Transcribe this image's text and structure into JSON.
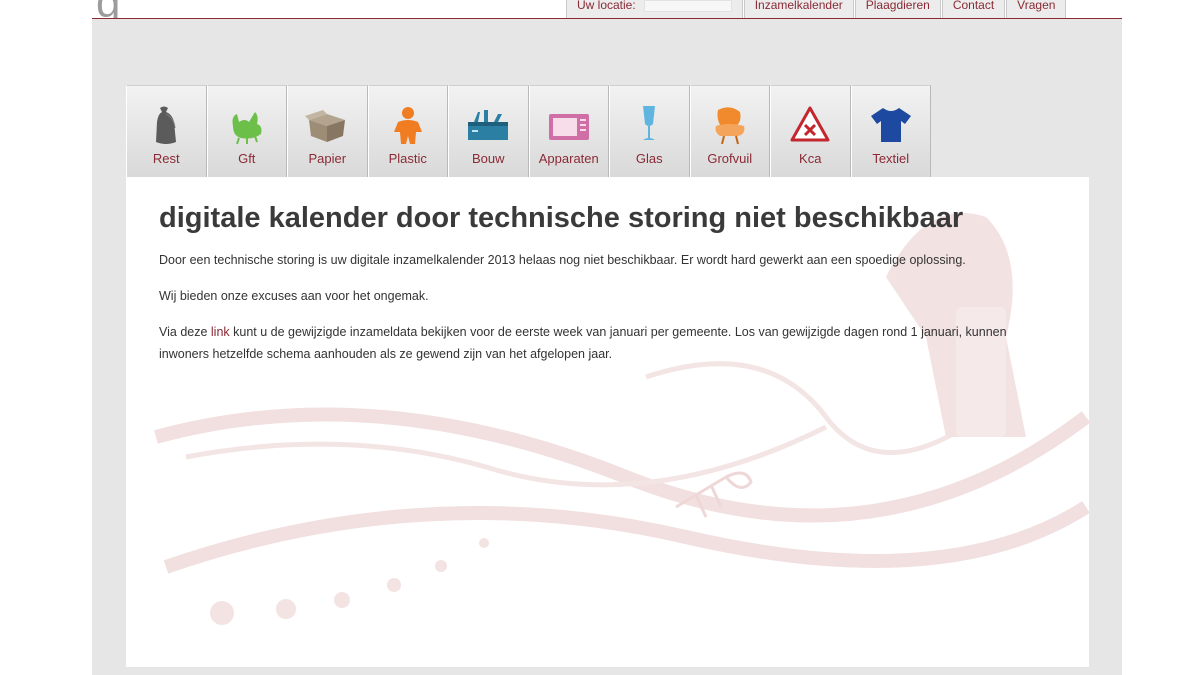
{
  "header": {
    "logo_fragment": "g",
    "nav": [
      {
        "label": "Uw locatie:",
        "has_input": true
      },
      {
        "label": "Inzamelkalender"
      },
      {
        "label": "Plaagdieren"
      },
      {
        "label": "Contact"
      },
      {
        "label": "Vragen"
      }
    ]
  },
  "categories": [
    {
      "label": "Rest",
      "icon": "trash-bag-icon",
      "color": "#5b5b5b"
    },
    {
      "label": "Gft",
      "icon": "green-waste-icon",
      "color": "#6cc04a"
    },
    {
      "label": "Papier",
      "icon": "cardboard-box-icon",
      "color": "#9d8c76"
    },
    {
      "label": "Plastic",
      "icon": "plastic-figure-icon",
      "color": "#f07d22"
    },
    {
      "label": "Bouw",
      "icon": "toolbox-icon",
      "color": "#2a7fa3"
    },
    {
      "label": "Apparaten",
      "icon": "microwave-icon",
      "color": "#d06fa6"
    },
    {
      "label": "Glas",
      "icon": "glass-icon",
      "color": "#5fb5e0"
    },
    {
      "label": "Grofvuil",
      "icon": "armchair-icon",
      "color": "#f08a2c"
    },
    {
      "label": "Kca",
      "icon": "hazard-triangle-icon",
      "color": "#c4262e"
    },
    {
      "label": "Textiel",
      "icon": "tshirt-icon",
      "color": "#1d4aa0"
    }
  ],
  "main": {
    "title": "digitale kalender door technische storing niet beschikbaar",
    "paragraph1": "Door een technische storing is uw digitale inzamelkalender 2013 helaas nog niet beschikbaar. Er wordt hard gewerkt aan een spoedige oplossing.",
    "paragraph2": "Wij bieden onze excuses aan voor het ongemak.",
    "paragraph3_before_link": "Via deze ",
    "paragraph3_link": "link",
    "paragraph3_after_link": " kunt u de gewijzigde inzameldata bekijken voor de eerste week van januari per gemeente. Los van gewijzigde dagen rond 1 januari, kunnen inwoners hetzelfde schema aanhouden als ze gewend zijn van het afgelopen jaar."
  },
  "colors": {
    "accent": "#8a2a35",
    "frame_background": "#e6e6e6",
    "title_text": "#3a3a3a"
  }
}
